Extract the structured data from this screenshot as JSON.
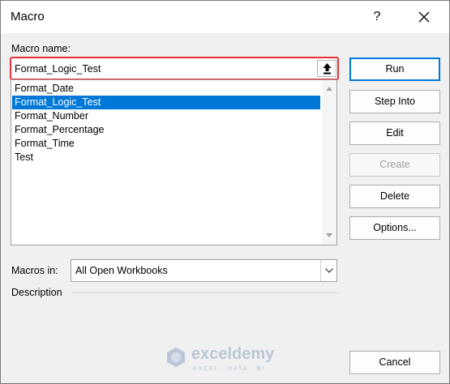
{
  "window": {
    "title": "Macro",
    "help_label": "?",
    "close_icon": "close-icon"
  },
  "macro_name": {
    "label": "Macro name:",
    "value": "Format_Logic_Test",
    "upload_icon": "upload-arrow-icon"
  },
  "macro_list": {
    "items": [
      "Format_Date",
      "Format_Logic_Test",
      "Format_Number",
      "Format_Percentage",
      "Format_Time",
      "Test"
    ],
    "selected_index": 1
  },
  "buttons": {
    "run": "Run",
    "step_into": "Step Into",
    "edit": "Edit",
    "create": "Create",
    "delete": "Delete",
    "options": "Options...",
    "cancel": "Cancel"
  },
  "macros_in": {
    "label": "Macros in:",
    "value": "All Open Workbooks"
  },
  "description": {
    "label": "Description"
  },
  "watermark": {
    "name": "exceldemy",
    "tagline": "EXCEL · DATA · BI"
  },
  "colors": {
    "selection": "#0078d7",
    "highlight_border": "#e5323c",
    "default_button_border": "#0078d7"
  }
}
